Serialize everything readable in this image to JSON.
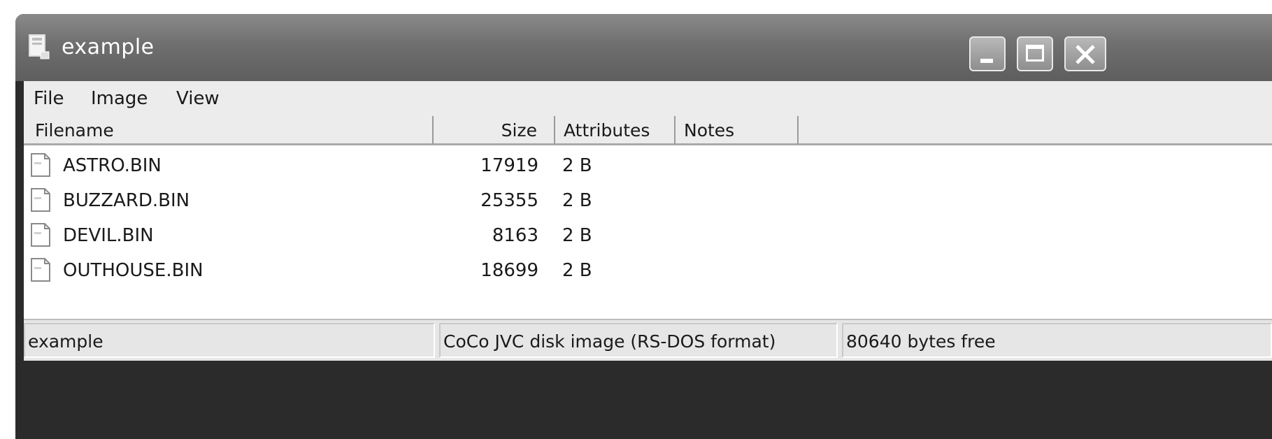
{
  "window": {
    "title": "example",
    "app_icon": "disk-document-icon",
    "buttons": {
      "minimize_icon": "minimize-icon",
      "maximize_icon": "maximize-icon",
      "close_icon": "close-icon"
    }
  },
  "menu": {
    "file": "File",
    "image": "Image",
    "view": "View"
  },
  "columns": {
    "filename": "Filename",
    "size": "Size",
    "attributes": "Attributes",
    "notes": "Notes"
  },
  "files": [
    {
      "name": "ASTRO.BIN",
      "size": "17919",
      "attributes": "2 B",
      "notes": "",
      "icon": "file-icon"
    },
    {
      "name": "BUZZARD.BIN",
      "size": "25355",
      "attributes": "2 B",
      "notes": "",
      "icon": "file-icon"
    },
    {
      "name": "DEVIL.BIN",
      "size": "8163",
      "attributes": "2 B",
      "notes": "",
      "icon": "file-icon"
    },
    {
      "name": "OUTHOUSE.BIN",
      "size": "18699",
      "attributes": "2 B",
      "notes": "",
      "icon": "file-icon"
    }
  ],
  "status": {
    "image_name": "example",
    "format": "CoCo JVC disk image (RS-DOS format)",
    "free": "80640 bytes free"
  }
}
